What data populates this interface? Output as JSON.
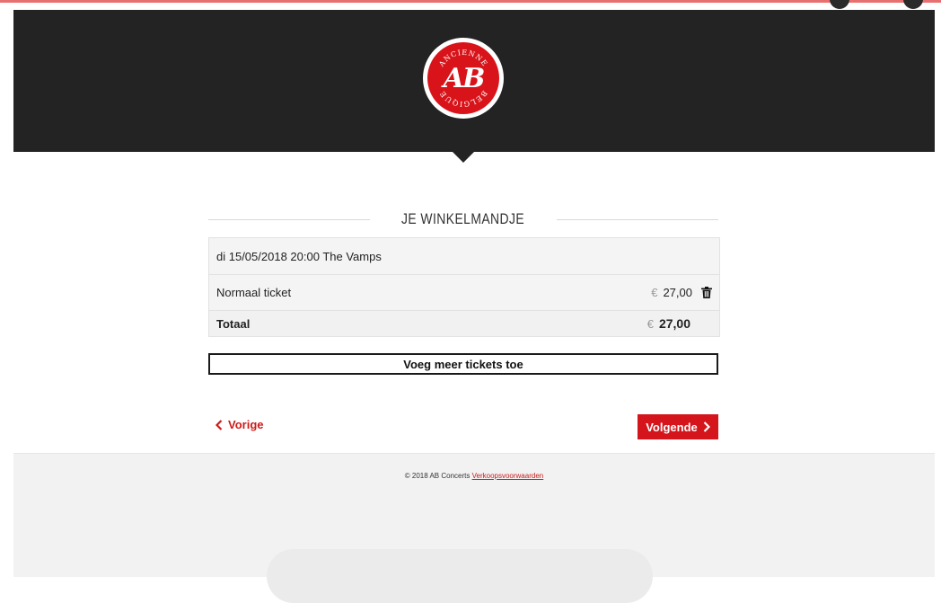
{
  "header": {
    "logo_text": "AB",
    "logo_ring_top": "ANCIENNE",
    "logo_ring_bottom": "BELGIQUE"
  },
  "cart": {
    "title": "JE WINKELMANDJE",
    "event": "di 15/05/2018 20:00 The Vamps",
    "ticket_label": "Normaal ticket",
    "ticket_currency": "€",
    "ticket_price": "27,00",
    "total_label": "Totaal",
    "total_currency": "€",
    "total_price": "27,00",
    "add_more_label": "Voeg meer tickets toe"
  },
  "nav": {
    "prev_label": "Vorige",
    "next_label": "Volgende"
  },
  "footer": {
    "copyright": "© 2018 AB Concerts",
    "terms_link": "Verkoopsvoorwaarden"
  },
  "colors": {
    "accent": "#d4161c",
    "header_bg": "#232323",
    "top_line": "#e86f6f"
  }
}
